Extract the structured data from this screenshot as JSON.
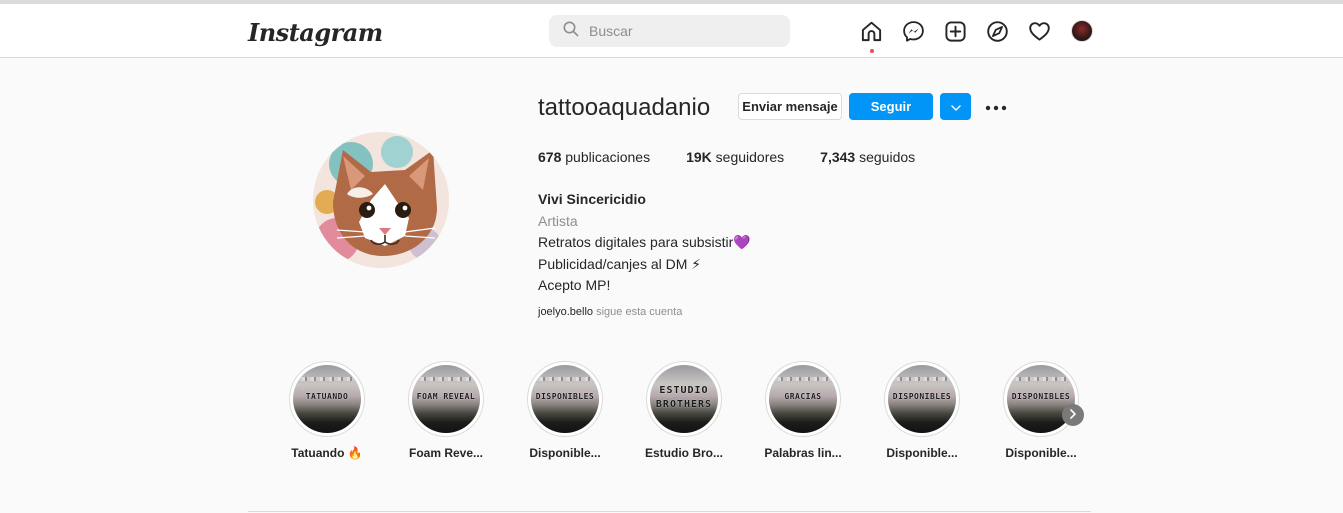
{
  "nav": {
    "logo": "Instagram",
    "search_placeholder": "Buscar",
    "icons": [
      "home-icon",
      "messenger-icon",
      "new-post-icon",
      "explore-icon",
      "activity-heart-icon",
      "profile-avatar"
    ]
  },
  "profile": {
    "username": "tattooaquadanio",
    "buttons": {
      "message": "Enviar mensaje",
      "follow": "Seguir"
    },
    "stats": {
      "posts_count": "678",
      "posts_label": " publicaciones",
      "followers_count": "19K",
      "followers_label": " seguidores",
      "following_count": "7,343",
      "following_label": " seguidos"
    },
    "bio": {
      "name": "Vivi Sincericidio",
      "category": "Artista",
      "line1": "Retratos digitales para subsistir💜",
      "line2": "Publicidad/canjes al DM ⚡",
      "line3": "Acepto MP!"
    },
    "followed_by": {
      "user": "joelyo.bello",
      "text": " sigue esta cuenta"
    }
  },
  "highlights": [
    {
      "label": "Tatuando 🔥",
      "cover_text": "TATUANDO"
    },
    {
      "label": "Foam Reve...",
      "cover_text": "FOAM REVEAL"
    },
    {
      "label": "Disponible...",
      "cover_text": "DISPONIBLES"
    },
    {
      "label": "Estudio Bro...",
      "cover_text_1": "ESTUDIO",
      "cover_text_2": "BROTHERS"
    },
    {
      "label": "Palabras lin...",
      "cover_text": "GRACIAS"
    },
    {
      "label": "Disponible...",
      "cover_text": "DISPONIBLES"
    },
    {
      "label": "Disponible...",
      "cover_text": "DISPONIBLES"
    }
  ],
  "colors": {
    "accent": "#0095f6",
    "notification_dot": "#ed4956",
    "background": "#fafafa",
    "border": "#dbdbdb"
  }
}
